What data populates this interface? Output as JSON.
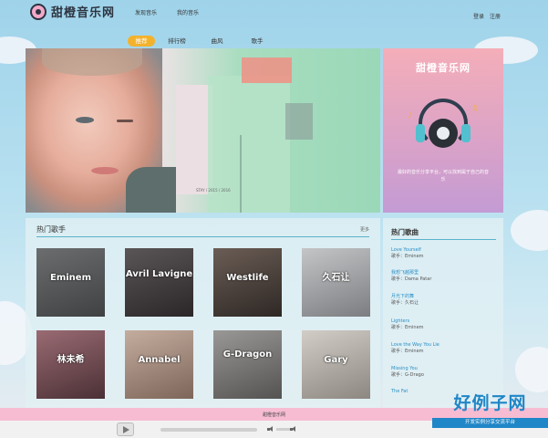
{
  "app": {
    "title": "甜橙音乐网",
    "nav": [
      "发现音乐",
      "我的音乐"
    ],
    "login": "登录",
    "register": "注册"
  },
  "subnav": {
    "tabs": [
      "推荐",
      "排行榜",
      "曲风",
      "歌手"
    ],
    "active": "推荐"
  },
  "banner": {
    "caption": "STAY / 2015 / 2016"
  },
  "promo": {
    "title": "甜橙音乐网",
    "description": "最好的音乐分享平台，可以找到属于自己的音乐"
  },
  "hot_singers": {
    "title": "热门歌手",
    "more": "更多",
    "singers": [
      {
        "name": "Eminem",
        "bg": "#545657"
      },
      {
        "name": "Avril Lavigne",
        "bg": "#3e3a3c"
      },
      {
        "name": "Westlife",
        "bg": "#4d4440"
      },
      {
        "name": "久石让",
        "bg": "#9b9c9e"
      },
      {
        "name": "林未希",
        "bg": "#6f4f56"
      },
      {
        "name": "Annabel",
        "bg": "#a69086"
      },
      {
        "name": "G-Dragon",
        "bg": "#7a7876"
      },
      {
        "name": "Gary",
        "bg": "#b3aea8"
      }
    ]
  },
  "hot_songs": {
    "title": "热门歌曲",
    "songs": [
      {
        "name": "Love Yourself",
        "artist": "歌手：Eminem"
      },
      {
        "name": "我想飞越那里",
        "artist": "歌手：Dama Patar"
      },
      {
        "name": "月光下的舞",
        "artist": "歌手：久石让"
      },
      {
        "name": "Lighters",
        "artist": "歌手：Eminem"
      },
      {
        "name": "Love the Way You Lie",
        "artist": "歌手：Eminem"
      },
      {
        "name": "Missing You",
        "artist": "歌手：G-Drago"
      },
      {
        "name": "The Fat",
        "artist": ""
      }
    ]
  },
  "footer": {
    "text": "甜橙音乐网"
  },
  "player": {
    "progress": 0
  },
  "badge": {
    "main": "好例子网",
    "sub": "开发实例分享交流平台"
  },
  "colors": {
    "accent": "#f2b22d",
    "link": "#2b8ec3",
    "divider": "#5ab3c9",
    "footer_pink": "#f7bcd2"
  }
}
